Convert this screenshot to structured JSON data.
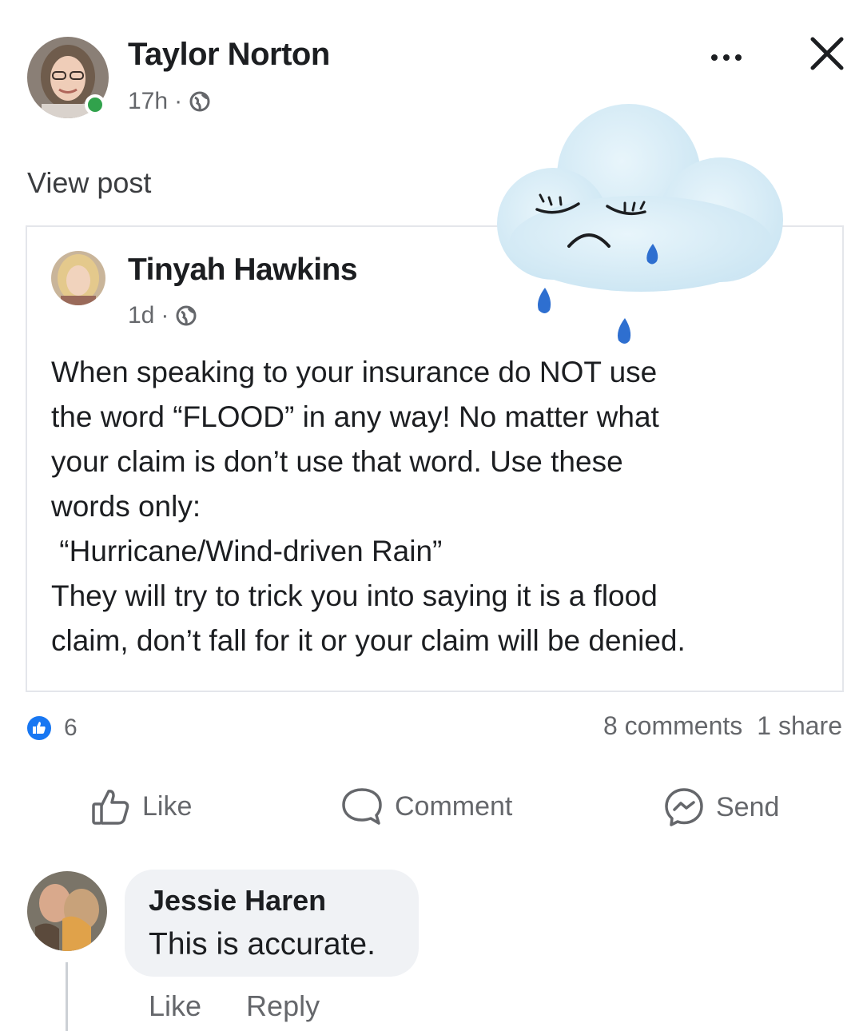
{
  "header": {
    "author": "Taylor Norton",
    "time": "17h",
    "separator": "·",
    "privacy_icon": "globe-icon",
    "more_icon": "more-icon",
    "close_icon": "close-icon",
    "view_post": "View post"
  },
  "shared_post": {
    "author": "Tinyah Hawkins",
    "time": "1d",
    "separator": "·",
    "privacy_icon": "globe-icon",
    "text": "When speaking to your insurance do NOT use\nthe word “FLOOD” in any way! No matter what\nyour claim is don’t use that word. Use these\nwords only:\n “Hurricane/Wind-driven Rain”\nThey will try to trick you into saying it is a flood\nclaim, don’t fall for it or your claim will be denied.",
    "sticker": "sad-raincloud-sticker"
  },
  "reactions": {
    "icon": "like-reaction-icon",
    "count": "6",
    "comments": "8 comments",
    "shares": "1 share"
  },
  "actions": {
    "like": "Like",
    "comment": "Comment",
    "send": "Send"
  },
  "comment": {
    "author": "Jessie Haren",
    "text": "This is accurate.",
    "like": "Like",
    "reply": "Reply"
  },
  "colors": {
    "brand_blue": "#1877f2",
    "online_green": "#31a24c",
    "muted_text": "#65676b",
    "bubble_bg": "#f0f2f5",
    "cloud": "#d7ecf7",
    "raindrop": "#2e6fd0"
  }
}
